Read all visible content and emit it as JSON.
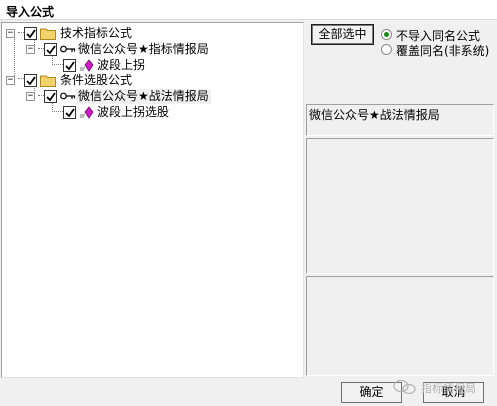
{
  "window": {
    "title": "导入公式"
  },
  "tree": {
    "groups": [
      {
        "label": "技术指标公式",
        "children": [
          {
            "label": "微信公众号★指标情报局",
            "children": [
              {
                "label": "波段上拐"
              }
            ]
          }
        ]
      },
      {
        "label": "条件选股公式",
        "children": [
          {
            "label": "微信公众号★战法情报局",
            "children": [
              {
                "label": "波段上拐选股"
              }
            ]
          }
        ]
      }
    ]
  },
  "controls": {
    "select_all_label": "全部选中",
    "radio_options": [
      {
        "label": "不导入同名公式",
        "selected": true
      },
      {
        "label": "覆盖同名(非系统)",
        "selected": false
      }
    ]
  },
  "info_panel": {
    "text": "微信公众号★战法情报局"
  },
  "footer": {
    "ok_label": "确定",
    "cancel_label": "取消",
    "watermark_text": "指标情报局"
  },
  "colors": {
    "radio_selected": "#1a8a1a",
    "formula_icon": "#d01cc8",
    "folder": "#f2d36b"
  }
}
